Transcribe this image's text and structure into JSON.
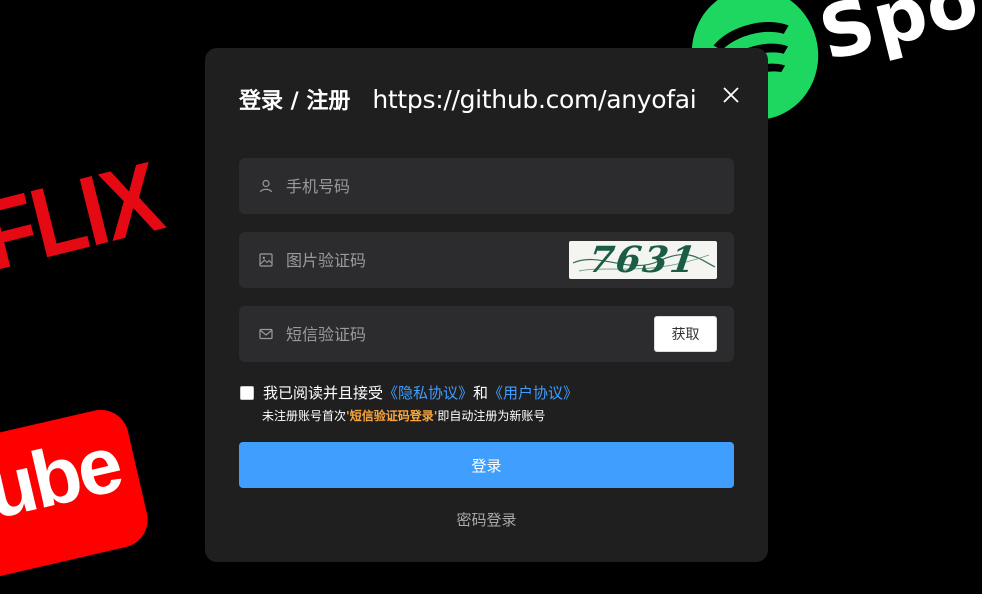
{
  "background": {
    "spotify_text": "Spot",
    "netflix_text": "FLIX",
    "youtube_text": "ube"
  },
  "dialog": {
    "title": "登录 / 注册",
    "subtitle": "https://github.com/anyofai",
    "close_icon": "close-icon",
    "phone": {
      "placeholder": "手机号码",
      "icon": "user-icon"
    },
    "image_code": {
      "placeholder": "图片验证码",
      "icon": "image-icon",
      "captcha_text": "7631"
    },
    "sms_code": {
      "placeholder": "短信验证码",
      "icon": "mail-icon",
      "button": "获取"
    },
    "agreement": {
      "prefix": "我已阅读并且接受",
      "privacy_link": "《隐私协议》",
      "and": "和",
      "user_link": "《用户协议》",
      "checked": false
    },
    "hint": {
      "prefix": "未注册账号首次",
      "emphasis": "'短信验证码登录'",
      "suffix": "即自动注册为新账号"
    },
    "login_button": "登录",
    "password_login": "密码登录"
  },
  "colors": {
    "accent": "#409eff",
    "dialog_bg": "#1f1f1f",
    "field_bg": "#2c2c2e",
    "hint_emphasis": "#f7a53d"
  }
}
